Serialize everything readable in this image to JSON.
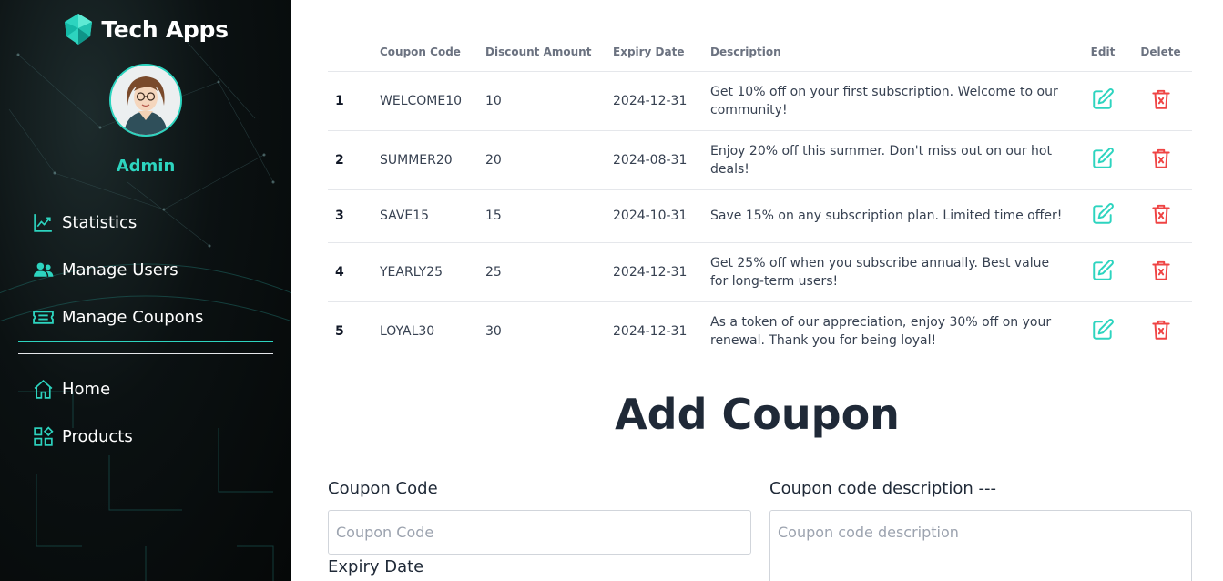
{
  "brand": {
    "name": "Tech Apps",
    "logo_icon": "crystal-logo-icon"
  },
  "profile": {
    "role": "Admin"
  },
  "sidebar": {
    "primary_items": [
      {
        "label": "Statistics",
        "icon": "chart-line-icon"
      },
      {
        "label": "Manage Users",
        "icon": "users-icon"
      },
      {
        "label": "Manage Coupons",
        "icon": "ticket-icon"
      }
    ],
    "secondary_items": [
      {
        "label": "Home",
        "icon": "home-icon"
      },
      {
        "label": "Products",
        "icon": "grid-icon"
      }
    ]
  },
  "colors": {
    "accent": "#2dd4bf",
    "danger": "#ef4444",
    "sidebar_bg": "#050808"
  },
  "table": {
    "headers": [
      "",
      "Coupon Code",
      "Discount Amount",
      "Expiry Date",
      "Description",
      "Edit",
      "Delete"
    ],
    "rows": [
      {
        "index": "1",
        "code": "WELCOME10",
        "discount": "10",
        "expiry": "2024-12-31",
        "description": "Get 10% off on your first subscription. Welcome to our community!"
      },
      {
        "index": "2",
        "code": "SUMMER20",
        "discount": "20",
        "expiry": "2024-08-31",
        "description": "Enjoy 20% off this summer. Don't miss out on our hot deals!"
      },
      {
        "index": "3",
        "code": "SAVE15",
        "discount": "15",
        "expiry": "2024-10-31",
        "description": "Save 15% on any subscription plan. Limited time offer!"
      },
      {
        "index": "4",
        "code": "YEARLY25",
        "discount": "25",
        "expiry": "2024-12-31",
        "description": "Get 25% off when you subscribe annually. Best value for long-term users!"
      },
      {
        "index": "5",
        "code": "LOYAL30",
        "discount": "30",
        "expiry": "2024-12-31",
        "description": "As a token of our appreciation, enjoy 30% off on your renewal. Thank you for being loyal!"
      }
    ]
  },
  "form": {
    "title": "Add Coupon",
    "code_label": "Coupon Code",
    "code_placeholder": "Coupon Code",
    "code_value": "",
    "description_label": "Coupon code description ---",
    "description_placeholder": "Coupon code description",
    "description_value": "",
    "expiry_label": "Expiry Date"
  }
}
